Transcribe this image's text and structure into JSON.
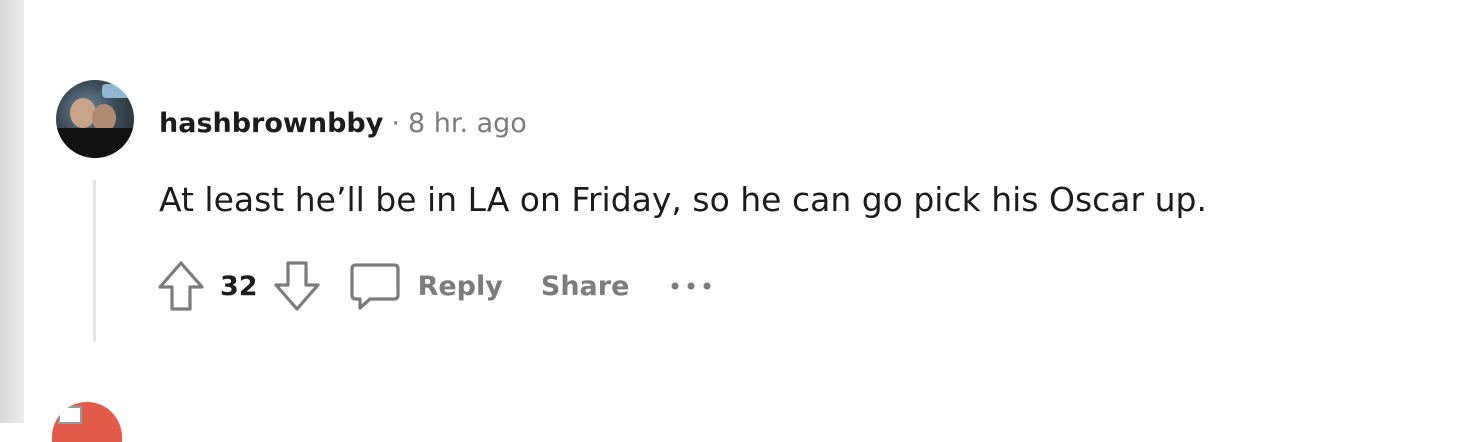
{
  "comment": {
    "username": "hashbrownbby",
    "separator": "·",
    "timestamp": "8 hr. ago",
    "body": "At least he’ll be in LA on Friday, so he can go pick his Oscar up.",
    "votes": "32",
    "reply_label": "Reply",
    "share_label": "Share",
    "more_label": "···"
  },
  "icons": {
    "upvote": "upvote-arrow-icon",
    "downvote": "downvote-arrow-icon",
    "reply": "speech-bubble-icon",
    "more": "ellipsis-icon"
  },
  "colors": {
    "text": "#1c1c1c",
    "muted": "#7c7c7c",
    "thread_line": "#e3e5e8"
  }
}
